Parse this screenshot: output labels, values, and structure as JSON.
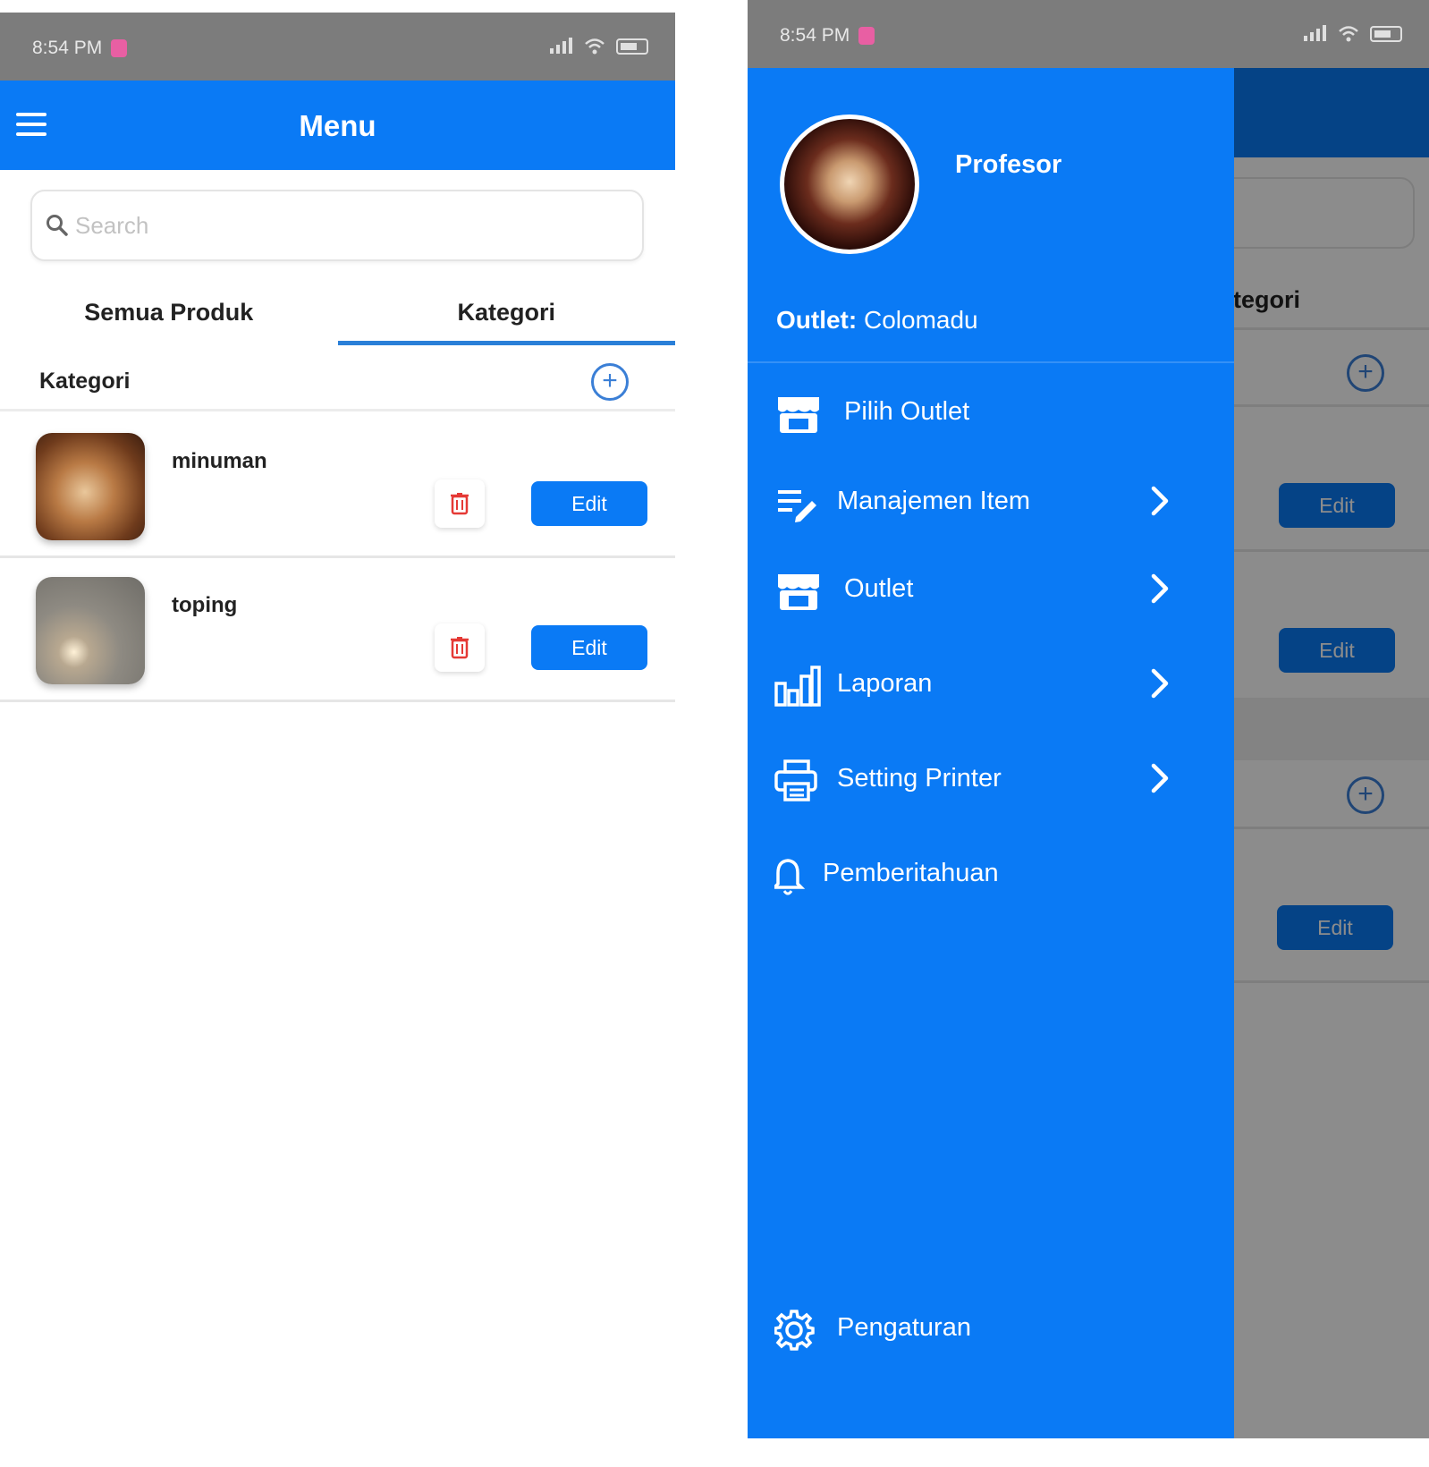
{
  "status_bar": {
    "time": "8:54 PM"
  },
  "left_screen": {
    "app_bar": {
      "title": "Menu"
    },
    "search": {
      "placeholder": "Search"
    },
    "tabs": [
      {
        "label": "Semua Produk",
        "active": false
      },
      {
        "label": "Kategori",
        "active": true
      }
    ],
    "section": {
      "label": "Kategori"
    },
    "categories": [
      {
        "name": "minuman",
        "edit_label": "Edit"
      },
      {
        "name": "toping",
        "edit_label": "Edit"
      }
    ]
  },
  "right_screen": {
    "drawer": {
      "profile_name": "Profesor",
      "outlet_label": "Outlet:",
      "outlet_value": "Colomadu",
      "items": [
        {
          "label": "Pilih Outlet",
          "icon": "store-icon",
          "has_chevron": false
        },
        {
          "label": "Manajemen Item",
          "icon": "edit-list-icon",
          "has_chevron": true
        },
        {
          "label": "Outlet",
          "icon": "store-icon",
          "has_chevron": true
        },
        {
          "label": "Laporan",
          "icon": "bar-chart-icon",
          "has_chevron": true
        },
        {
          "label": "Setting Printer",
          "icon": "printer-icon",
          "has_chevron": true
        },
        {
          "label": "Pemberitahuan",
          "icon": "bell-icon",
          "has_chevron": false
        }
      ],
      "footer_item": {
        "label": "Pengaturan",
        "icon": "gear-icon"
      }
    },
    "background": {
      "tab_fragment": "ategori",
      "edit_labels": [
        "Edit",
        "Edit",
        "Edit"
      ]
    }
  },
  "colors": {
    "primary": "#0a7af5",
    "status_bar": "#7c7c7c",
    "delete_red": "#e53935",
    "tab_underline": "#2a7fd8"
  }
}
